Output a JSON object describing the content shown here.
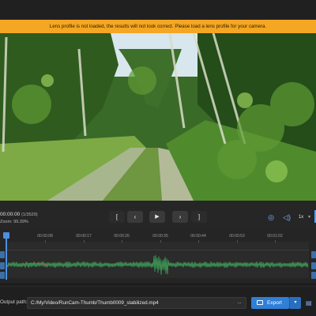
{
  "warning": {
    "text": "Lens profile is not loaded, the results will not look correct. Please load a lens profile for your camera."
  },
  "player": {
    "timecode": "00:00:00",
    "frame": "(1/3520)",
    "zoom": "Zoom: 99.39%",
    "buttons": {
      "bracket_left": "[",
      "prev": "‹",
      "play": "▶",
      "next": "›",
      "bracket_right": "]"
    },
    "speed": "1x"
  },
  "timeline": {
    "ticks": [
      "00:00:08",
      "00:00:17",
      "00:00:26",
      "00:00:35",
      "00:00:44",
      "00:00:53",
      "00:01:02"
    ],
    "colors": {
      "waveform": "#3fa45a",
      "playhead": "#4e8fe0"
    }
  },
  "footer": {
    "output_label": "Output path:",
    "output_path": "C:/My/Video/RunCam-Thumb/Thumb0009_stabilized.mp4",
    "browse": "...",
    "export_label": "Export"
  },
  "colors": {
    "warning_bg": "#f5a623",
    "accent": "#2f7fd6"
  }
}
